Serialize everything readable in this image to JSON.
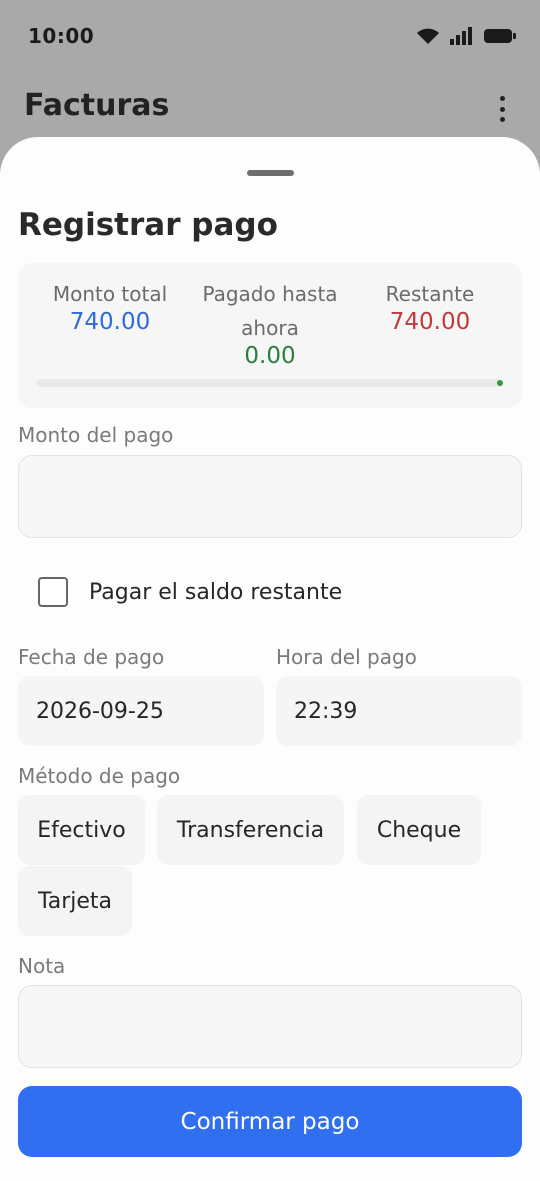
{
  "status_bar": {
    "time": "10:00"
  },
  "app_bar": {
    "title": "Facturas"
  },
  "sheet": {
    "title": "Registrar pago",
    "summary": {
      "total_label": "Monto total",
      "total_value": "740.00",
      "paid_label_line1": "Pagado hasta",
      "paid_label_line2": "ahora",
      "paid_value": "0.00",
      "remaining_label": "Restante",
      "remaining_value": "740.00",
      "paid_fraction": 0.0
    },
    "amount": {
      "label": "Monto del pago",
      "value": ""
    },
    "pay_remaining": {
      "label": "Pagar el saldo restante",
      "checked": false
    },
    "date": {
      "label": "Fecha de pago",
      "value": "2026-09-25"
    },
    "time": {
      "label": "Hora del pago",
      "value": "22:39"
    },
    "method": {
      "label": "Método de pago",
      "options": [
        "Efectivo",
        "Transferencia",
        "Cheque",
        "Tarjeta"
      ]
    },
    "note": {
      "label": "Nota",
      "value": ""
    },
    "confirm_label": "Confirmar pago"
  },
  "colors": {
    "primary": "#306ff0",
    "total": "#2e6bd6",
    "paid": "#2e7d3e",
    "remaining": "#c0393b"
  }
}
